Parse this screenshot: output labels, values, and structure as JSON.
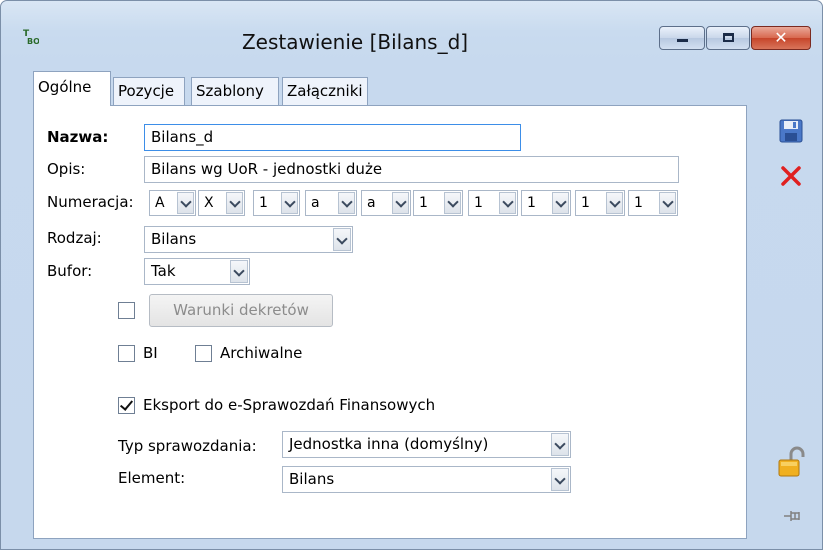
{
  "window": {
    "title": "Zestawienie [Bilans_d]",
    "min_glyph": "",
    "close_glyph": "✕"
  },
  "tabs": [
    {
      "label": "Ogólne",
      "active": true
    },
    {
      "label": "Pozycje"
    },
    {
      "label": "Szablony"
    },
    {
      "label": "Załączniki"
    }
  ],
  "form": {
    "nazwa_label": "Nazwa:",
    "nazwa_value": "Bilans_d",
    "opis_label": "Opis:",
    "opis_value": "Bilans wg UoR - jednostki duże",
    "numeracja_label": "Numeracja:",
    "numeracja_values": [
      "A",
      "X",
      "1",
      "a",
      "a",
      "1",
      "1",
      "1",
      "1",
      "1"
    ],
    "rodzaj_label": "Rodzaj:",
    "rodzaj_value": "Bilans",
    "bufor_label": "Bufor:",
    "bufor_value": "Tak",
    "warunki_button": "Warunki dekretów",
    "bi_label": "BI",
    "archiwalne_label": "Archiwalne",
    "eksport_label": "Eksport do e-Sprawozdań Finansowych",
    "eksport_checked": true,
    "typ_label": "Typ sprawozdania:",
    "typ_value": "Jednostka inna (domyślny)",
    "element_label": "Element:",
    "element_value": "Bilans"
  },
  "icons": {
    "app": "TBO",
    "save": "save-icon",
    "delete": "delete-icon",
    "lock": "padlock-icon",
    "pin": "pin-icon"
  },
  "colors": {
    "focus_border": "#3d8ee8",
    "close_button": "#c6452a",
    "delete_red": "#e02020"
  }
}
